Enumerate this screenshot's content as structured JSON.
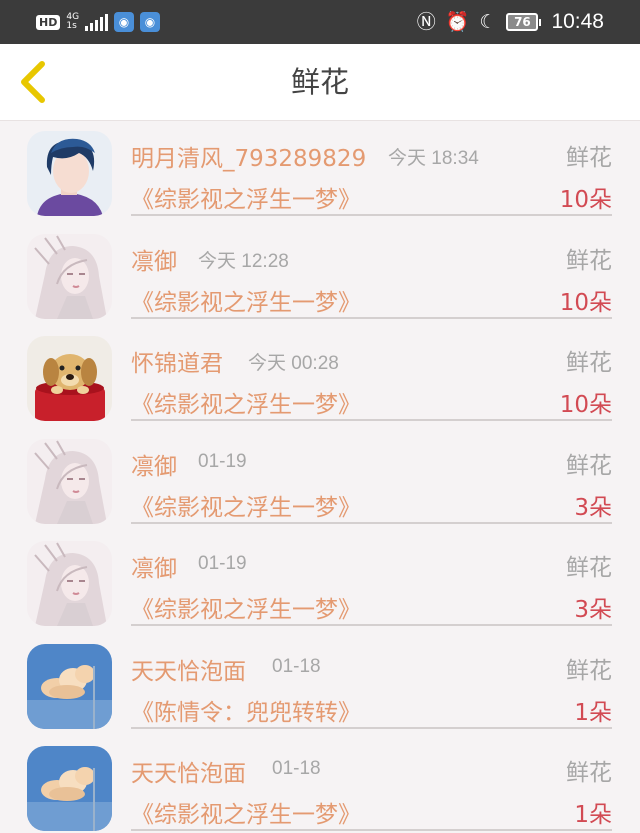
{
  "status_bar": {
    "hd": "HD",
    "network": "4G",
    "network_sub": "1s",
    "battery": "76",
    "time": "10:48",
    "icons": [
      "nfc-icon",
      "alarm-icon",
      "moon-icon"
    ]
  },
  "header": {
    "title": "鲜花",
    "back_icon": "chevron-left-icon",
    "back_color": "#e8c700"
  },
  "colors": {
    "name": "#e49a71",
    "count": "#d24a53",
    "muted": "#a7a7a7"
  },
  "records": [
    {
      "name": "明月清风_793289829",
      "time": "今天 18:34",
      "type": "鲜花",
      "book": "《综影视之浮生一梦》",
      "count": "10朵",
      "avatar": "dark-hair-boy-avatar"
    },
    {
      "name": "凛御",
      "time": "今天 12:28",
      "type": "鲜花",
      "book": "《综影视之浮生一梦》",
      "count": "10朵",
      "avatar": "white-hair-illustration-avatar"
    },
    {
      "name": "怀锦道君",
      "time": "今天 00:28",
      "type": "鲜花",
      "book": "《综影视之浮生一梦》",
      "count": "10朵",
      "avatar": "puppy-photo-avatar"
    },
    {
      "name": "凛御",
      "time": "01-19",
      "type": "鲜花",
      "book": "《综影视之浮生一梦》",
      "count": "3朵",
      "avatar": "white-hair-illustration-avatar"
    },
    {
      "name": "凛御",
      "time": "01-19",
      "type": "鲜花",
      "book": "《综影视之浮生一梦》",
      "count": "3朵",
      "avatar": "white-hair-illustration-avatar"
    },
    {
      "name": "天天恰泡面",
      "time": "01-18",
      "type": "鲜花",
      "book": "《陈情令：兜兜转转》",
      "count": "1朵",
      "avatar": "cloud-sky-avatar"
    },
    {
      "name": "天天恰泡面",
      "time": "01-18",
      "type": "鲜花",
      "book": "《综影视之浮生一梦》",
      "count": "1朵",
      "avatar": "cloud-sky-avatar"
    }
  ]
}
